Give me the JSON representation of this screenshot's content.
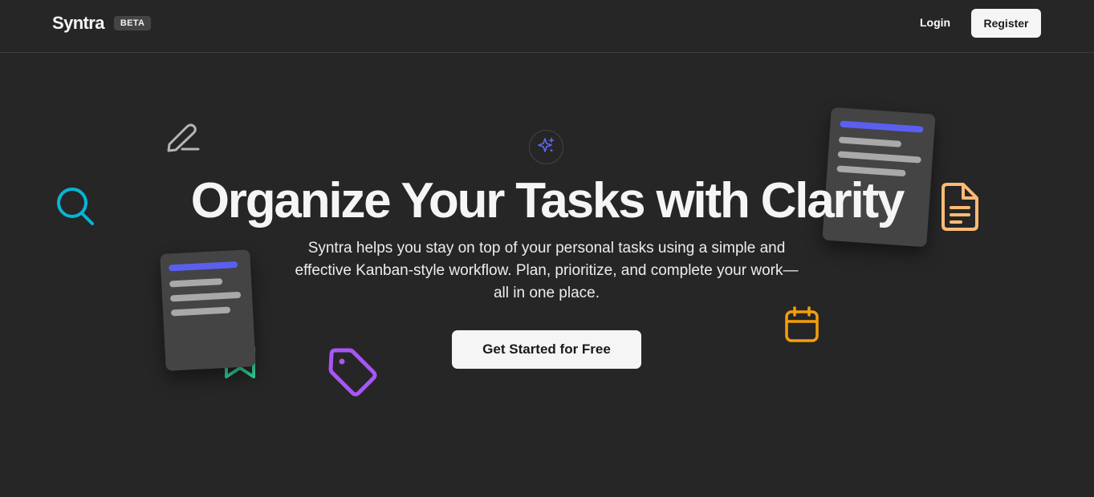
{
  "header": {
    "brand": "Syntra",
    "badge": "BETA",
    "login_label": "Login",
    "register_label": "Register"
  },
  "hero": {
    "title": "Organize Your Tasks with Clarity",
    "description_lines": [
      "Syntra helps you stay on top of your personal tasks using a simple and",
      "effective Kanban-style workflow. Plan, prioritize, and complete your work—",
      "all in one place."
    ],
    "cta_label": "Get Started for Free"
  },
  "decorations": {
    "icons": [
      "pencil-icon",
      "search-icon",
      "sparkle-icon",
      "document-icon",
      "calendar-icon",
      "tag-icon",
      "bookmark-icon"
    ]
  },
  "colors": {
    "background": "#262626",
    "accent_blue": "#5b5ff0",
    "search_cyan": "#06b6d4",
    "tag_purple": "#a855f7",
    "document_peach": "#fdba74",
    "calendar_orange": "#f59e0b",
    "bookmark_green": "#34d399"
  }
}
